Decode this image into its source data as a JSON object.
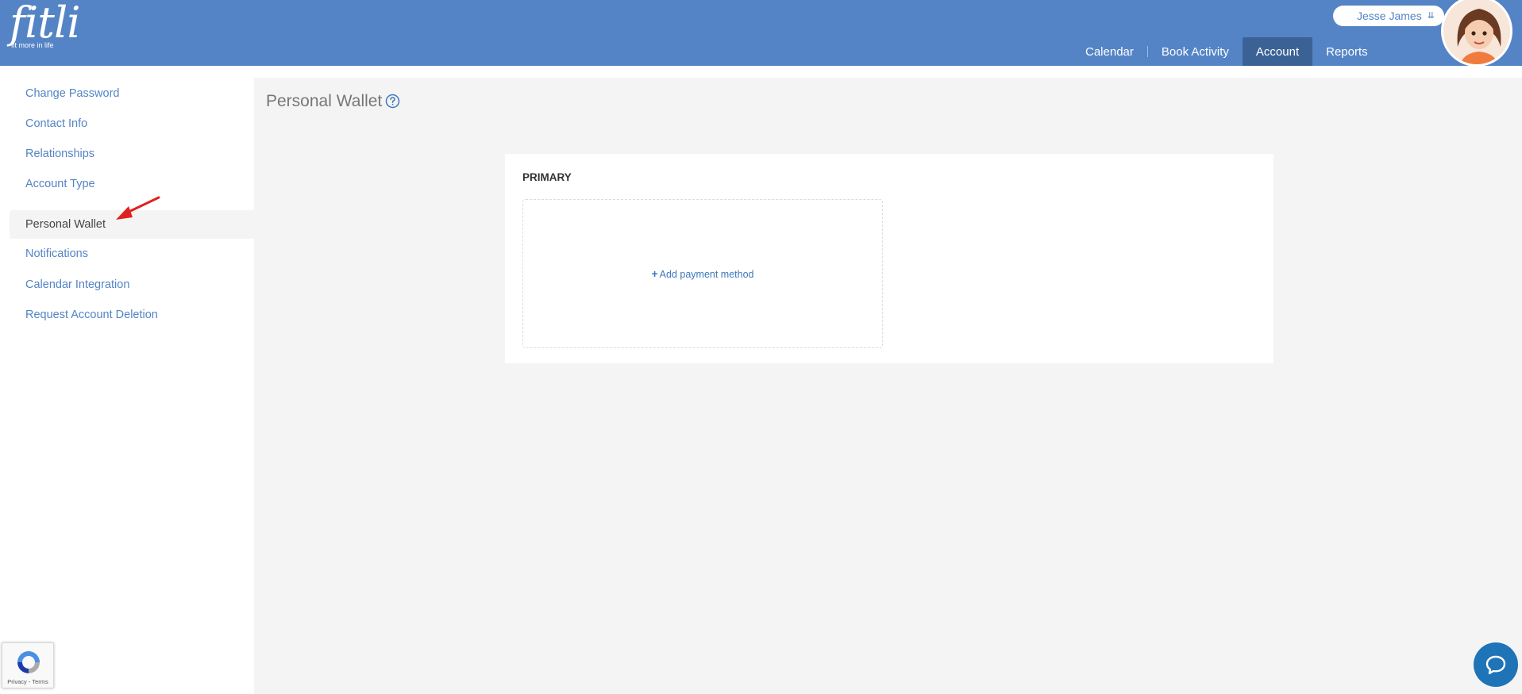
{
  "brand": {
    "name": "fitli",
    "tagline": "fit more in life"
  },
  "user": {
    "name": "Jesse James",
    "chevron_icon": "double-chevron-down-icon",
    "avatar_icon": "user-avatar"
  },
  "nav": {
    "items": [
      {
        "label": "Calendar"
      },
      {
        "label": "Book Activity"
      },
      {
        "label": "Account",
        "active": true
      },
      {
        "label": "Reports"
      }
    ]
  },
  "sidebar": {
    "items": [
      {
        "label": "Change Password"
      },
      {
        "label": "Contact Info"
      },
      {
        "label": "Relationships"
      },
      {
        "label": "Account Type"
      },
      {
        "label": "Personal Wallet",
        "active": true
      },
      {
        "label": "Notifications"
      },
      {
        "label": "Calendar Integration"
      },
      {
        "label": "Request Account Deletion"
      }
    ]
  },
  "main": {
    "title": "Personal Wallet",
    "help_icon": "question-circle-icon",
    "section_label": "PRIMARY",
    "add_payment_label": "Add payment method"
  },
  "recaptcha": {
    "terms": "Privacy - Terms"
  },
  "colors": {
    "header": "#5484c5",
    "nav_active": "#3a6295",
    "link": "#5484c5",
    "annotation_arrow": "#e02020",
    "chat": "#1f73b7"
  }
}
